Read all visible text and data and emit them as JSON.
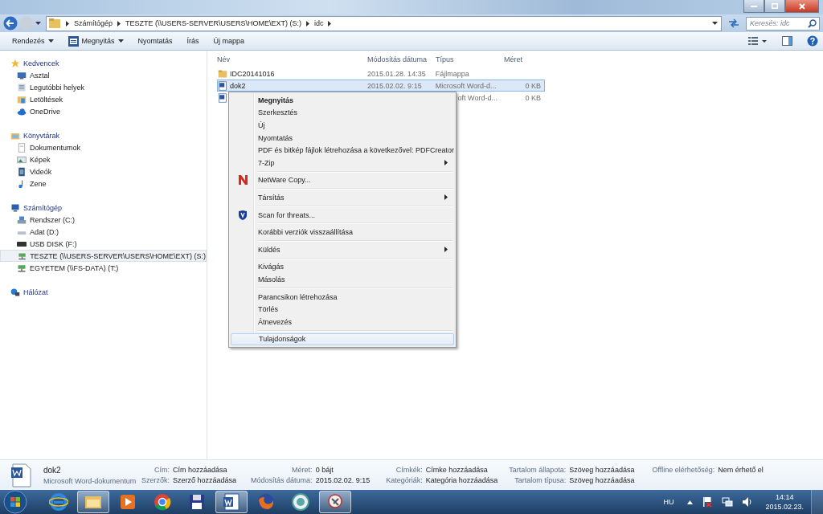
{
  "address_bar": {
    "breadcrumbs": [
      "Számítógép",
      "TESZTE (\\\\USERS-SERVER\\USERS\\HOME\\EXT) (S:)",
      "idc"
    ],
    "search": {
      "placeholder": "Keresés: idc"
    }
  },
  "toolbar": {
    "buttons": [
      {
        "label": "Rendezés",
        "dropdown": true,
        "kind": "plain"
      },
      {
        "label": "Megnyitás",
        "dropdown": true,
        "kind": "app"
      },
      {
        "label": "Nyomtatás",
        "dropdown": false,
        "kind": "plain"
      },
      {
        "label": "Írás",
        "dropdown": false,
        "kind": "plain"
      },
      {
        "label": "Új mappa",
        "dropdown": false,
        "kind": "plain"
      }
    ]
  },
  "sidebar": {
    "groups": [
      {
        "label": "Kedvencek",
        "kind": "star",
        "items": [
          {
            "label": "Asztal",
            "kind": "desktop",
            "selected": false
          },
          {
            "label": "Legutóbbi helyek",
            "kind": "recent",
            "selected": false
          },
          {
            "label": "Letöltések",
            "kind": "downloads",
            "selected": false
          },
          {
            "label": "OneDrive",
            "kind": "cloud",
            "selected": false
          }
        ]
      },
      {
        "label": "Könyvtárak",
        "kind": "library",
        "items": [
          {
            "label": "Dokumentumok",
            "kind": "document",
            "selected": false
          },
          {
            "label": "Képek",
            "kind": "pictures",
            "selected": false
          },
          {
            "label": "Videók",
            "kind": "videos",
            "selected": false
          },
          {
            "label": "Zene",
            "kind": "music",
            "selected": false
          }
        ]
      },
      {
        "label": "Számítógép",
        "kind": "computer",
        "items": [
          {
            "label": "Rendszer (C:)",
            "kind": "sysdrive",
            "selected": false
          },
          {
            "label": "Adat (D:)",
            "kind": "drive",
            "selected": false
          },
          {
            "label": "USB DISK (F:)",
            "kind": "usb",
            "selected": false
          },
          {
            "label": "TESZTE (\\\\USERS-SERVER\\USERS\\HOME\\EXT) (S:)",
            "kind": "netdrive",
            "selected": true
          },
          {
            "label": "EGYETEM (\\\\FS-DATA) (T:)",
            "kind": "netdrive",
            "selected": false
          }
        ]
      },
      {
        "label": "Hálózat",
        "kind": "network"
      }
    ]
  },
  "file_list": {
    "columns": [
      "Név",
      "Módosítás dátuma",
      "Típus",
      "Méret"
    ],
    "rows": [
      {
        "name": "IDC20141016",
        "date": "2015.01.28. 14:35",
        "type": "Fájlmappa",
        "kind": "folder",
        "selected": false,
        "covered": false
      },
      {
        "name": "dok2",
        "date": "2015.02.02. 9:15",
        "type": "Microsoft Word-d...",
        "size": "0 KB",
        "kind": "word",
        "selected": true,
        "covered": false
      },
      {
        "type": "oft Word-d...",
        "size": "0 KB",
        "kind": "word",
        "selected": false,
        "covered": true
      }
    ]
  },
  "context_menu": {
    "groups": [
      [
        {
          "label": "Megnyitás",
          "bold": true,
          "submenu": false,
          "kind": "plain",
          "selected": false
        },
        {
          "label": "Szerkesztés",
          "bold": false,
          "submenu": false,
          "kind": "plain",
          "selected": false
        },
        {
          "label": "Új",
          "bold": false,
          "submenu": false,
          "kind": "plain",
          "selected": false
        },
        {
          "label": "Nyomtatás",
          "bold": false,
          "submenu": false,
          "kind": "plain",
          "selected": false
        },
        {
          "label": "PDF és bitkép fájlok létrehozása a következővel: PDFCreator",
          "bold": false,
          "submenu": false,
          "kind": "plain",
          "selected": false
        },
        {
          "label": "7-Zip",
          "bold": false,
          "submenu": true,
          "kind": "plain",
          "selected": false
        }
      ],
      [
        {
          "label": "NetWare Copy...",
          "bold": false,
          "submenu": false,
          "kind": "netware",
          "selected": false
        }
      ],
      [
        {
          "label": "Társítás",
          "bold": false,
          "submenu": true,
          "kind": "plain",
          "selected": false
        }
      ],
      [
        {
          "label": "Scan for threats...",
          "bold": false,
          "submenu": false,
          "kind": "shield",
          "selected": false
        }
      ],
      [
        {
          "label": "Korábbi verziók visszaállítása",
          "bold": false,
          "submenu": false,
          "kind": "plain",
          "selected": false
        }
      ],
      [
        {
          "label": "Küldés",
          "bold": false,
          "submenu": true,
          "kind": "plain",
          "selected": false
        }
      ],
      [
        {
          "label": "Kivágás",
          "bold": false,
          "submenu": false,
          "kind": "plain",
          "selected": false
        },
        {
          "label": "Másolás",
          "bold": false,
          "submenu": false,
          "kind": "plain",
          "selected": false
        }
      ],
      [
        {
          "label": "Parancsikon létrehozása",
          "bold": false,
          "submenu": false,
          "kind": "plain",
          "selected": false
        },
        {
          "label": "Törlés",
          "bold": false,
          "submenu": false,
          "kind": "plain",
          "selected": false
        },
        {
          "label": "Átnevezés",
          "bold": false,
          "submenu": false,
          "kind": "plain",
          "selected": false
        }
      ],
      [
        {
          "label": "Tulajdonságok",
          "bold": false,
          "submenu": false,
          "kind": "plain",
          "selected": true
        }
      ]
    ]
  },
  "details_pane": {
    "name": "dok2",
    "type": "Microsoft Word-dokumentum",
    "columns": [
      [
        {
          "label": "Cím:",
          "value": "Cím hozzáadása"
        },
        {
          "label": "Szerzők:",
          "value": "Szerző hozzáadása"
        }
      ],
      [
        {
          "label": "Méret:",
          "value": "0 bájt"
        },
        {
          "label": "Módosítás dátuma:",
          "value": "2015.02.02. 9:15"
        }
      ],
      [
        {
          "label": "Címkék:",
          "value": "Címke hozzáadása"
        },
        {
          "label": "Kategóriák:",
          "value": "Kategória hozzáadása"
        }
      ],
      [
        {
          "label": "Tartalom állapota:",
          "value": "Szöveg hozzáadása"
        },
        {
          "label": "Tartalom típusa:",
          "value": "Szöveg hozzáadása"
        }
      ],
      [
        {
          "label": "Offline elérhetőség:",
          "value": "Nem érhető el"
        }
      ]
    ]
  },
  "taskbar": {
    "apps": [
      {
        "kind": "ie",
        "active": false
      },
      {
        "kind": "explorer",
        "active": true
      },
      {
        "kind": "media",
        "active": false
      },
      {
        "kind": "chrome",
        "active": false
      },
      {
        "kind": "floppy",
        "active": false
      },
      {
        "kind": "word",
        "active": true
      },
      {
        "kind": "firefox",
        "active": false
      },
      {
        "kind": "globe",
        "active": false
      },
      {
        "kind": "tool",
        "active": true
      }
    ],
    "language": "HU",
    "time": "14:14",
    "date": "2015.02.23."
  }
}
